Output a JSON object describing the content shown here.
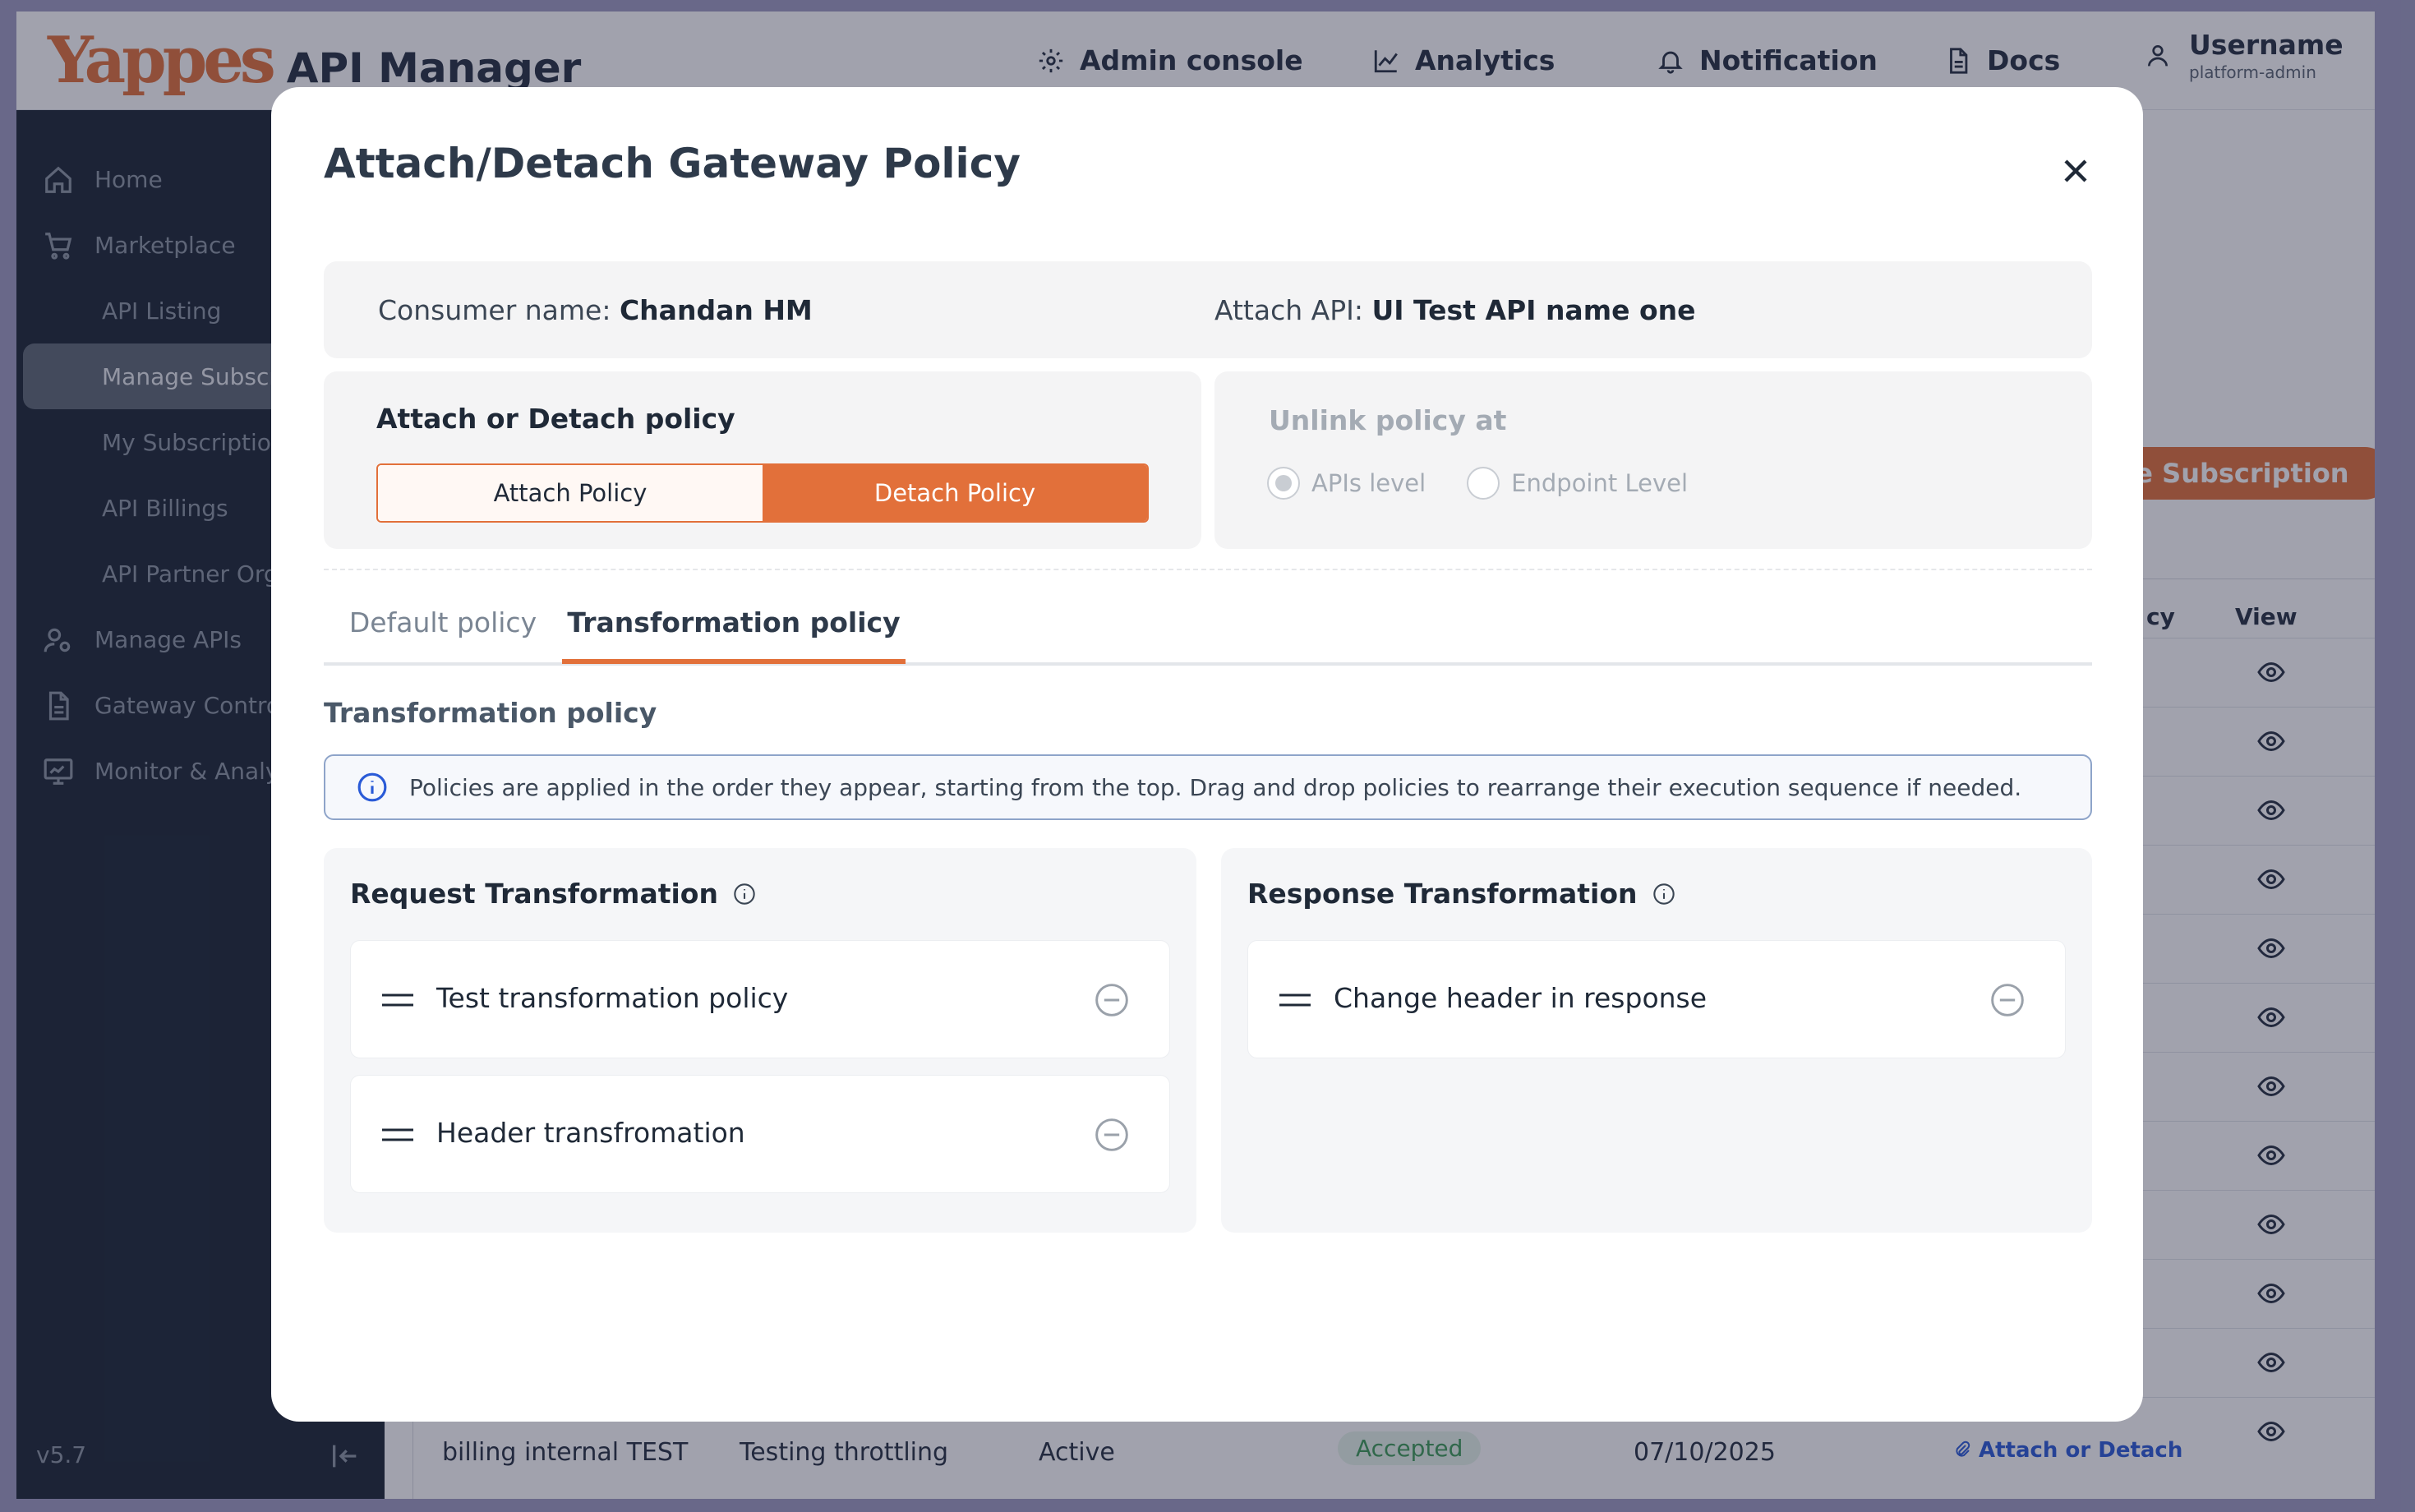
{
  "header": {
    "logo_text": "Yappes",
    "app_name": "API Manager",
    "nav": [
      {
        "label": "Admin console",
        "icon": "gear-icon"
      },
      {
        "label": "Analytics",
        "icon": "chart-icon"
      },
      {
        "label": "Notification",
        "icon": "bell-icon"
      },
      {
        "label": "Docs",
        "icon": "document-icon"
      }
    ],
    "user": {
      "name": "Username",
      "role": "platform-admin"
    }
  },
  "sidebar": {
    "items": [
      {
        "label": "Home",
        "icon": "home-icon"
      },
      {
        "label": "Marketplace",
        "icon": "cart-icon"
      },
      {
        "label": "API Listing"
      },
      {
        "label": "Manage Subscri"
      },
      {
        "label": "My Subscription"
      },
      {
        "label": "API Billings"
      },
      {
        "label": "API Partner Org"
      },
      {
        "label": "Manage APIs",
        "icon": "user-gear-icon"
      },
      {
        "label": "Gateway Contro",
        "icon": "file-icon"
      },
      {
        "label": "Monitor & Analy",
        "icon": "monitor-icon"
      }
    ],
    "version": "v5.7"
  },
  "background": {
    "create_button": "ate Subscription",
    "columns": {
      "policy": "cy",
      "view": "View"
    },
    "last_row": {
      "name": "billing internal TEST",
      "plan": "Testing throttling",
      "status": "Active",
      "approval": "Accepted",
      "date": "07/10/2025",
      "action": "Attach or Detach"
    }
  },
  "modal": {
    "title": "Attach/Detach Gateway Policy",
    "consumer_label": "Consumer name:",
    "consumer_value": "Chandan HM",
    "api_label": "Attach API:",
    "api_value": "UI Test API name one",
    "attach_detach": {
      "heading": "Attach or Detach policy",
      "options": [
        "Attach Policy",
        "Detach Policy"
      ],
      "selected": "Detach Policy"
    },
    "unlink": {
      "heading": "Unlink policy at",
      "options": [
        "APIs level",
        "Endpoint Level"
      ],
      "selected": "APIs level",
      "disabled": true
    },
    "tabs": [
      "Default policy",
      "Transformation policy"
    ],
    "active_tab": "Transformation policy",
    "section_title": "Transformation policy",
    "notice": "Policies are applied in the order they appear, starting from the top. Drag and drop policies to rearrange their execution sequence if needed.",
    "request": {
      "title": "Request Transformation",
      "items": [
        "Test transformation policy",
        "Header transfromation"
      ]
    },
    "response": {
      "title": "Response Transformation",
      "items": [
        "Change header in response"
      ]
    }
  },
  "colors": {
    "accent": "#e2703a",
    "sidebar": "#1a2533",
    "link": "#2a5bd7"
  }
}
